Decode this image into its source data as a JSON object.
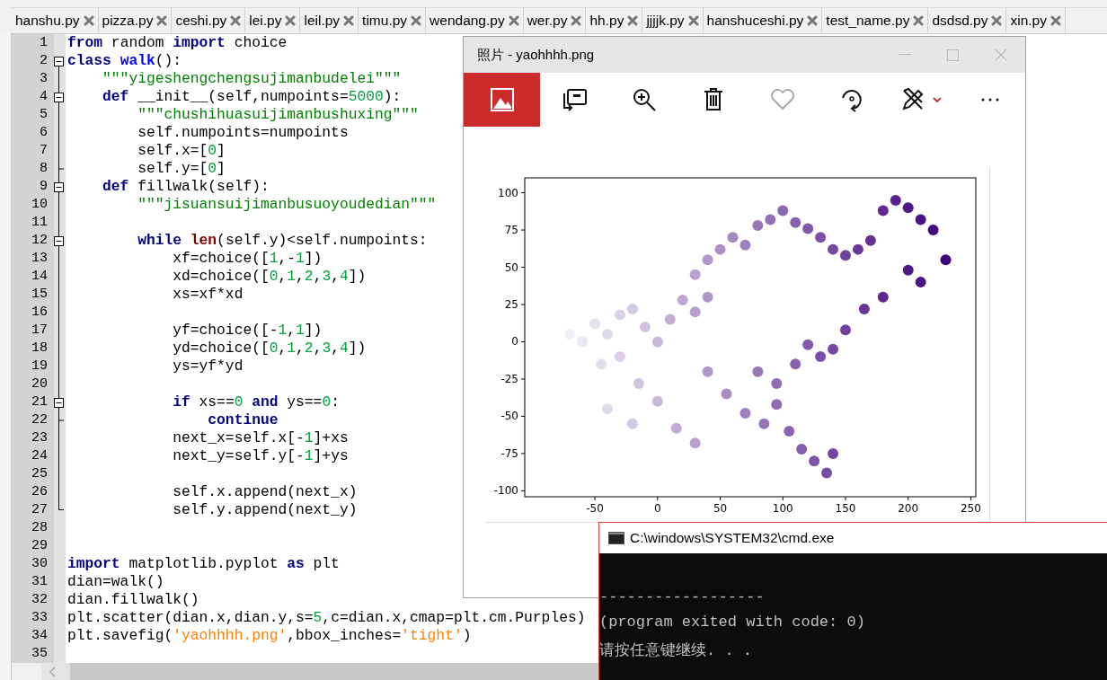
{
  "tabs": [
    {
      "label": "hanshu.py",
      "selected": false
    },
    {
      "label": "pizza.py",
      "selected": false
    },
    {
      "label": "ceshi.py",
      "selected": false
    },
    {
      "label": "lei.py",
      "selected": false
    },
    {
      "label": "leil.py",
      "selected": false
    },
    {
      "label": "timu.py",
      "selected": false
    },
    {
      "label": "wendang.py",
      "selected": false
    },
    {
      "label": "wer.py",
      "selected": false
    },
    {
      "label": "hh.py",
      "selected": false
    },
    {
      "label": "jjjjk.py",
      "selected": false
    },
    {
      "label": "hanshuceshi.py",
      "selected": false
    },
    {
      "label": "test_name.py",
      "selected": false
    },
    {
      "label": "dsdsd.py",
      "selected": false
    },
    {
      "label": "xin.py",
      "selected": false
    }
  ],
  "editor": {
    "lines": [
      {
        "number": "1",
        "fold": false,
        "tokens": [
          {
            "kind": "keyword",
            "text": "from"
          },
          {
            "kind": "plain",
            "text": " random "
          },
          {
            "kind": "keyword",
            "text": "import"
          },
          {
            "kind": "plain",
            "text": " choice"
          }
        ]
      },
      {
        "number": "2",
        "fold": true,
        "tokens": [
          {
            "kind": "keyword",
            "text": "class "
          },
          {
            "kind": "classname",
            "text": "walk"
          },
          {
            "kind": "plain",
            "text": "():"
          }
        ]
      },
      {
        "number": "3",
        "fold": false,
        "tokens": [
          {
            "kind": "string",
            "text": "    \"\"\"yigeshengchengsujimanbudelei\"\"\""
          }
        ]
      },
      {
        "number": "4",
        "fold": true,
        "tokens": [
          {
            "kind": "keyword",
            "text": "    def"
          },
          {
            "kind": "plain",
            "text": " __init__(self,numpoints="
          },
          {
            "kind": "number",
            "text": "5000"
          },
          {
            "kind": "plain",
            "text": "):"
          }
        ]
      },
      {
        "number": "5",
        "fold": false,
        "tokens": [
          {
            "kind": "string",
            "text": "        \"\"\"chushihuasuijimanbushuxing\"\"\""
          }
        ]
      },
      {
        "number": "6",
        "fold": false,
        "tokens": [
          {
            "kind": "plain",
            "text": "        self.numpoints=numpoints"
          }
        ]
      },
      {
        "number": "7",
        "fold": false,
        "tokens": [
          {
            "kind": "plain",
            "text": "        self.x=["
          },
          {
            "kind": "number",
            "text": "0"
          },
          {
            "kind": "plain",
            "text": "]"
          }
        ]
      },
      {
        "number": "8",
        "fold": false,
        "tokens": [
          {
            "kind": "plain",
            "text": "        self.y=["
          },
          {
            "kind": "number",
            "text": "0"
          },
          {
            "kind": "plain",
            "text": "]"
          }
        ]
      },
      {
        "number": "9",
        "fold": true,
        "tokens": [
          {
            "kind": "keyword",
            "text": "    def"
          },
          {
            "kind": "plain",
            "text": " fillwalk(self):"
          }
        ]
      },
      {
        "number": "10",
        "fold": false,
        "tokens": [
          {
            "kind": "string",
            "text": "        \"\"\"jisuansuijimanbusuoyoudedian\"\"\""
          }
        ]
      },
      {
        "number": "11",
        "fold": false
      },
      {
        "number": "12",
        "fold": true,
        "tokens": [
          {
            "kind": "keyword",
            "text": "        while"
          },
          {
            "kind": "builtin",
            "text": " len"
          },
          {
            "kind": "plain",
            "text": "(self.y)<self.numpoints:"
          }
        ]
      },
      {
        "number": "13",
        "fold": false,
        "tokens": [
          {
            "kind": "plain",
            "text": "            xf=choice(["
          },
          {
            "kind": "number",
            "text": "1"
          },
          {
            "kind": "plain",
            "text": ",-"
          },
          {
            "kind": "number",
            "text": "1"
          },
          {
            "kind": "plain",
            "text": "])"
          }
        ]
      },
      {
        "number": "14",
        "fold": false,
        "tokens": [
          {
            "kind": "plain",
            "text": "            xd=choice(["
          },
          {
            "kind": "number",
            "text": "0"
          },
          {
            "kind": "plain",
            "text": ","
          },
          {
            "kind": "number",
            "text": "1"
          },
          {
            "kind": "plain",
            "text": ","
          },
          {
            "kind": "number",
            "text": "2"
          },
          {
            "kind": "plain",
            "text": ","
          },
          {
            "kind": "number",
            "text": "3"
          },
          {
            "kind": "plain",
            "text": ","
          },
          {
            "kind": "number",
            "text": "4"
          },
          {
            "kind": "plain",
            "text": "])"
          }
        ]
      },
      {
        "number": "15",
        "fold": false,
        "tokens": [
          {
            "kind": "plain",
            "text": "            xs=xf*xd"
          }
        ]
      },
      {
        "number": "16",
        "fold": false
      },
      {
        "number": "17",
        "fold": false,
        "tokens": [
          {
            "kind": "plain",
            "text": "            yf=choice([-"
          },
          {
            "kind": "number",
            "text": "1"
          },
          {
            "kind": "plain",
            "text": ","
          },
          {
            "kind": "number",
            "text": "1"
          },
          {
            "kind": "plain",
            "text": "])"
          }
        ]
      },
      {
        "number": "18",
        "fold": false,
        "tokens": [
          {
            "kind": "plain",
            "text": "            yd=choice(["
          },
          {
            "kind": "number",
            "text": "0"
          },
          {
            "kind": "plain",
            "text": ","
          },
          {
            "kind": "number",
            "text": "1"
          },
          {
            "kind": "plain",
            "text": ","
          },
          {
            "kind": "number",
            "text": "2"
          },
          {
            "kind": "plain",
            "text": ","
          },
          {
            "kind": "number",
            "text": "3"
          },
          {
            "kind": "plain",
            "text": ","
          },
          {
            "kind": "number",
            "text": "4"
          },
          {
            "kind": "plain",
            "text": "])"
          }
        ]
      },
      {
        "number": "19",
        "fold": false,
        "tokens": [
          {
            "kind": "plain",
            "text": "            ys=yf*yd"
          }
        ]
      },
      {
        "number": "20",
        "fold": false
      },
      {
        "number": "21",
        "fold": true,
        "tokens": [
          {
            "kind": "keyword",
            "text": "            if"
          },
          {
            "kind": "plain",
            "text": " xs=="
          },
          {
            "kind": "number",
            "text": "0"
          },
          {
            "kind": "keyword",
            "text": " and"
          },
          {
            "kind": "plain",
            "text": " ys=="
          },
          {
            "kind": "number",
            "text": "0"
          },
          {
            "kind": "plain",
            "text": ":"
          }
        ]
      },
      {
        "number": "22",
        "fold": false,
        "tokens": [
          {
            "kind": "keyword",
            "text": "                continue"
          }
        ]
      },
      {
        "number": "23",
        "fold": false,
        "tokens": [
          {
            "kind": "plain",
            "text": "            next_x=self.x[-"
          },
          {
            "kind": "number",
            "text": "1"
          },
          {
            "kind": "plain",
            "text": "]+xs"
          }
        ]
      },
      {
        "number": "24",
        "fold": false,
        "tokens": [
          {
            "kind": "plain",
            "text": "            next_y=self.y[-"
          },
          {
            "kind": "number",
            "text": "1"
          },
          {
            "kind": "plain",
            "text": "]+ys"
          }
        ]
      },
      {
        "number": "25",
        "fold": false
      },
      {
        "number": "26",
        "fold": false,
        "tokens": [
          {
            "kind": "plain",
            "text": "            self.x.append(next_x)"
          }
        ]
      },
      {
        "number": "27",
        "fold": false,
        "tokens": [
          {
            "kind": "plain",
            "text": "            self.y.append(next_y)"
          }
        ]
      },
      {
        "number": "28",
        "fold": false
      },
      {
        "number": "29",
        "fold": false
      },
      {
        "number": "30",
        "fold": false,
        "tokens": [
          {
            "kind": "keyword",
            "text": "import"
          },
          {
            "kind": "plain",
            "text": " matplotlib.pyplot "
          },
          {
            "kind": "keyword",
            "text": "as"
          },
          {
            "kind": "plain",
            "text": " plt"
          }
        ]
      },
      {
        "number": "31",
        "fold": false,
        "tokens": [
          {
            "kind": "plain",
            "text": "dian=walk()"
          }
        ]
      },
      {
        "number": "32",
        "fold": false,
        "tokens": [
          {
            "kind": "plain",
            "text": "dian.fillwalk()"
          }
        ]
      },
      {
        "number": "33",
        "fold": false,
        "tokens": [
          {
            "kind": "plain",
            "text": "plt.scatter(dian.x,dian.y,s="
          },
          {
            "kind": "number",
            "text": "5"
          },
          {
            "kind": "plain",
            "text": ",c=dian.x,cmap=plt.cm.Purples)"
          }
        ]
      },
      {
        "number": "34",
        "fold": false,
        "tokens": [
          {
            "kind": "plain",
            "text": "plt.savefig("
          },
          {
            "kind": "quoted",
            "text": "'yaohhhh.png'"
          },
          {
            "kind": "plain",
            "text": ",bbox_inches="
          },
          {
            "kind": "quoted",
            "text": "'tight'"
          },
          {
            "kind": "plain",
            "text": ")"
          }
        ]
      },
      {
        "number": "35",
        "fold": false
      }
    ]
  },
  "photos_window": {
    "title": "照片 - yaohhhh.png",
    "chart_data": {
      "type": "scatter",
      "xlim": [
        -106,
        254
      ],
      "ylim": [
        -104,
        110
      ],
      "xticks": [
        -50,
        0,
        50,
        100,
        150,
        200,
        250
      ],
      "yticks": [
        -100,
        -75,
        -50,
        -25,
        0,
        25,
        50,
        75,
        100
      ],
      "x": [
        -70,
        -60,
        -50,
        -40,
        -30,
        -20,
        -10,
        0,
        10,
        20,
        30,
        40,
        -45,
        -30,
        -15,
        0,
        15,
        30,
        -40,
        -20,
        30,
        40,
        50,
        60,
        70,
        80,
        90,
        100,
        110,
        120,
        130,
        140,
        150,
        160,
        170,
        180,
        190,
        200,
        210,
        220,
        230,
        200,
        210,
        180,
        165,
        150,
        140,
        130,
        120,
        110,
        40,
        55,
        70,
        85,
        95,
        105,
        115,
        125,
        135,
        140,
        95,
        80
      ],
      "series": [
        {
          "values": [
            5,
            0,
            12,
            5,
            18,
            22,
            10,
            0,
            15,
            28,
            20,
            30,
            -15,
            -10,
            -28,
            -40,
            -58,
            -68,
            -45,
            -55,
            45,
            55,
            62,
            70,
            65,
            78,
            82,
            88,
            80,
            76,
            70,
            62,
            58,
            62,
            68,
            88,
            95,
            90,
            82,
            75,
            55,
            48,
            40,
            30,
            22,
            8,
            -5,
            -10,
            -2,
            -15,
            -20,
            -35,
            -48,
            -55,
            -42,
            -60,
            -72,
            -80,
            -88,
            -75,
            -28,
            -20
          ]
        }
      ]
    }
  },
  "console_window": {
    "title": "C:\\windows\\SYSTEM32\\cmd.exe",
    "lines": [
      "------------------",
      "(program exited with code: 0)",
      "请按任意键继续. . ."
    ]
  }
}
